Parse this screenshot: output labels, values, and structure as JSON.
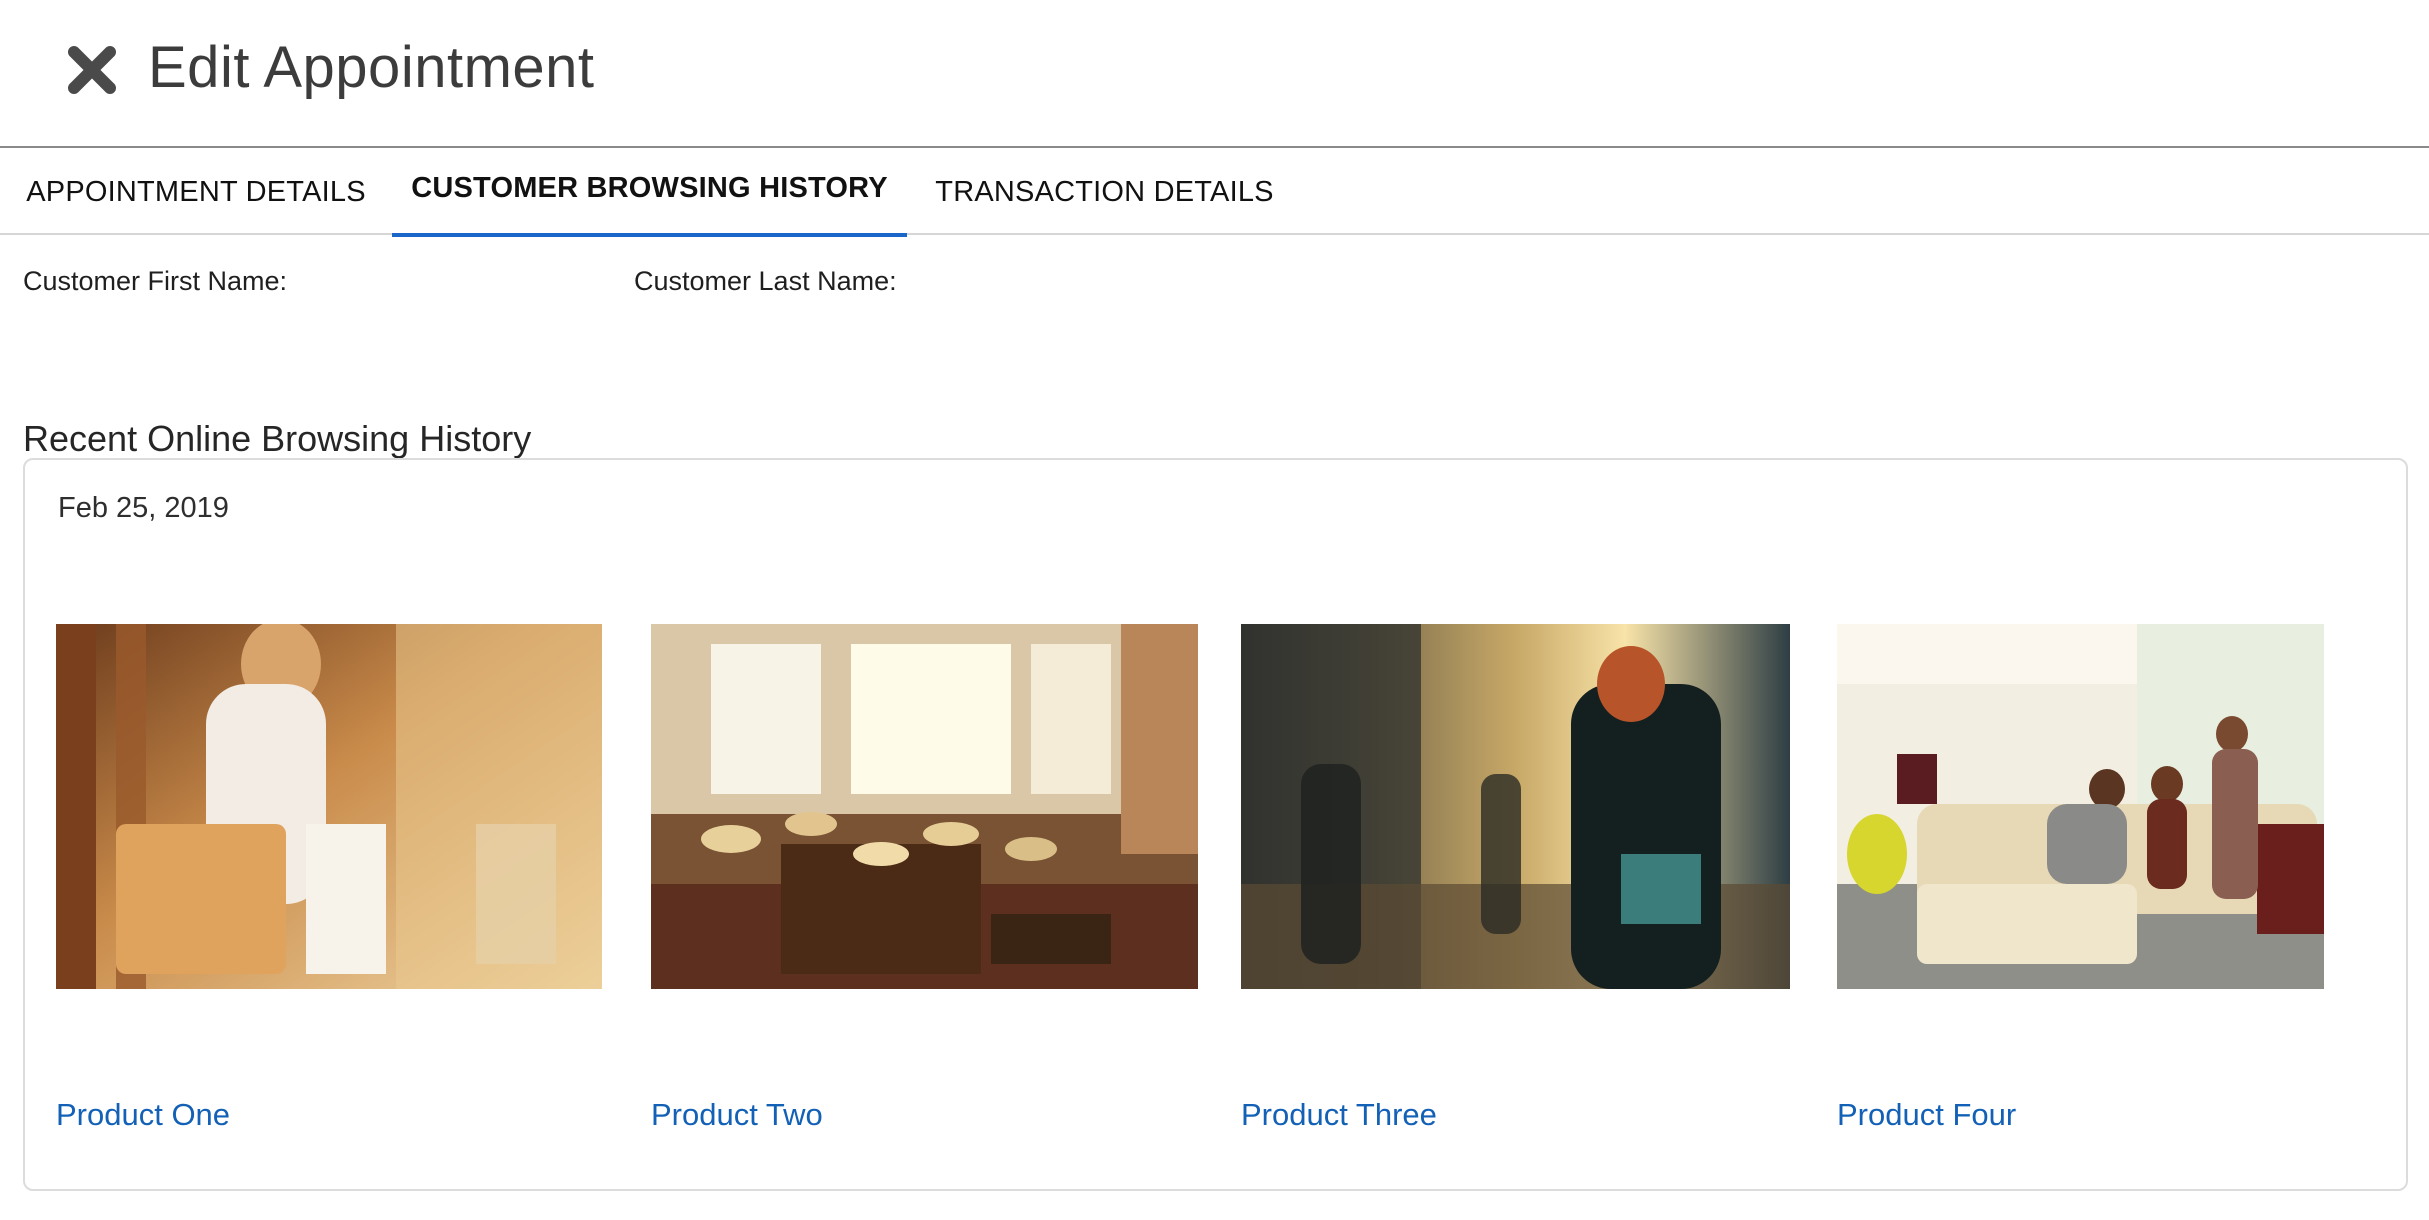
{
  "header": {
    "title": "Edit Appointment",
    "close_icon": "close-x-icon"
  },
  "tabs": [
    {
      "label": "APPOINTMENT DETAILS",
      "active": false
    },
    {
      "label": "CUSTOMER BROWSING HISTORY",
      "active": true
    },
    {
      "label": "TRANSACTION DETAILS",
      "active": false
    }
  ],
  "customer": {
    "first_name_label": "Customer First Name:",
    "last_name_label": "Customer Last Name:"
  },
  "history": {
    "heading": "Recent Online Browsing History",
    "date": "Feb 25, 2019",
    "products": [
      {
        "name": "Product One",
        "image": "woman-with-shopping-bags-photo"
      },
      {
        "name": "Product Two",
        "image": "hat-store-interior-photo"
      },
      {
        "name": "Product Three",
        "image": "woman-on-city-street-photo"
      },
      {
        "name": "Product Four",
        "image": "furniture-showroom-photo"
      }
    ]
  },
  "colors": {
    "accent": "#1b66c9",
    "link": "#1361b6",
    "divider": "#8a8a8a"
  }
}
